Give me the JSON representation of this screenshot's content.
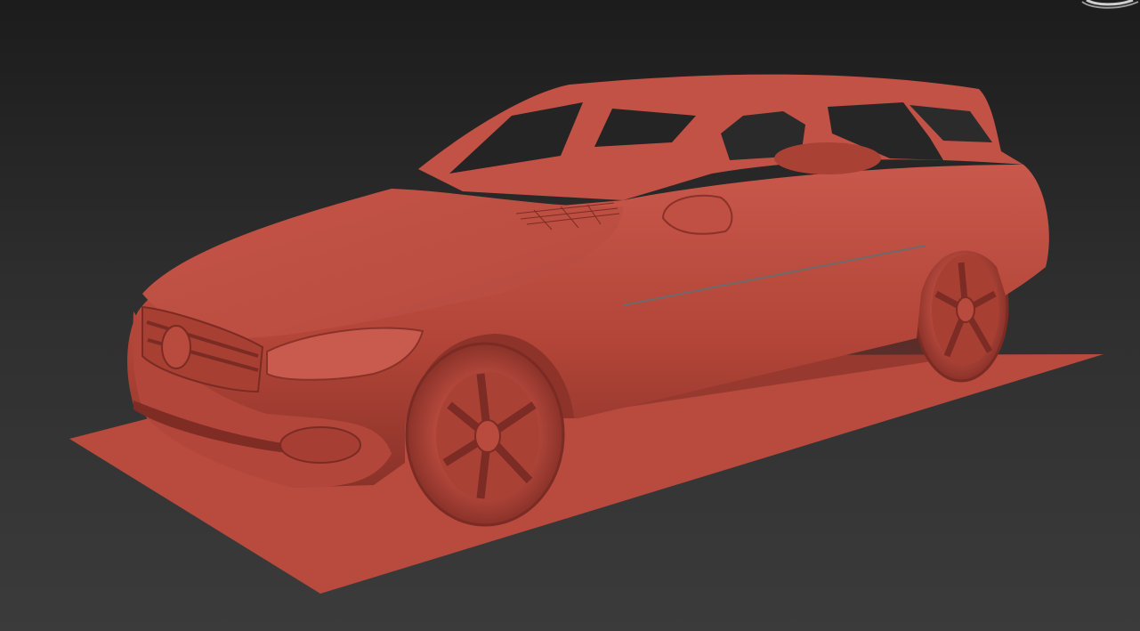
{
  "viewport": {
    "background_top": "#1c1c1c",
    "background_bottom": "#3b3b3b",
    "shaded_color": "#b84a3e",
    "shadow_color": "#7e2c24",
    "highlight_color": "#d0695c"
  },
  "scene": {
    "model": "station-wagon",
    "ground_plane": true,
    "viewcube_visible": true
  }
}
